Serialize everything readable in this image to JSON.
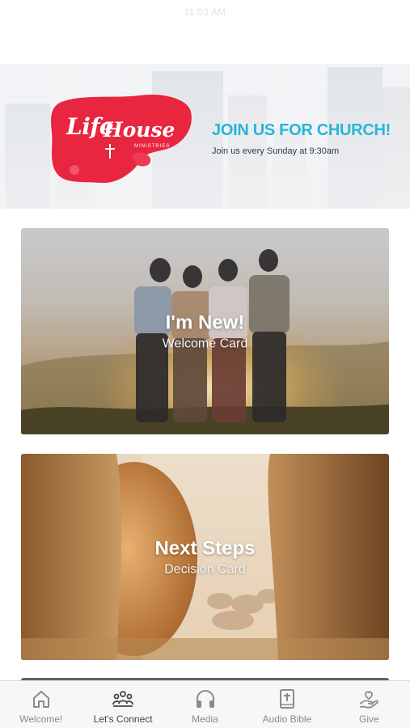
{
  "status_bar": {
    "time": "11:03 AM"
  },
  "banner": {
    "logo_text_life": "Life",
    "logo_text_house": "House",
    "logo_sub": "MINISTRIES",
    "title": "JOIN US FOR CHURCH!",
    "subtitle": "Join us every Sunday at 9:30am",
    "title_color": "#27b6d8",
    "logo_color": "#e8263f"
  },
  "cards": [
    {
      "title": "I'm New!",
      "subtitle": "Welcome Card"
    },
    {
      "title": "Next Steps",
      "subtitle": "Decision Card"
    }
  ],
  "tab_bar": {
    "active_index": 1,
    "tabs": [
      {
        "label": "Welcome!",
        "icon": "home-icon"
      },
      {
        "label": "Let's Connect",
        "icon": "people-group-icon"
      },
      {
        "label": "Media",
        "icon": "headphones-icon"
      },
      {
        "label": "Audio Bible",
        "icon": "bible-icon"
      },
      {
        "label": "Give",
        "icon": "give-hand-heart-icon"
      }
    ]
  }
}
